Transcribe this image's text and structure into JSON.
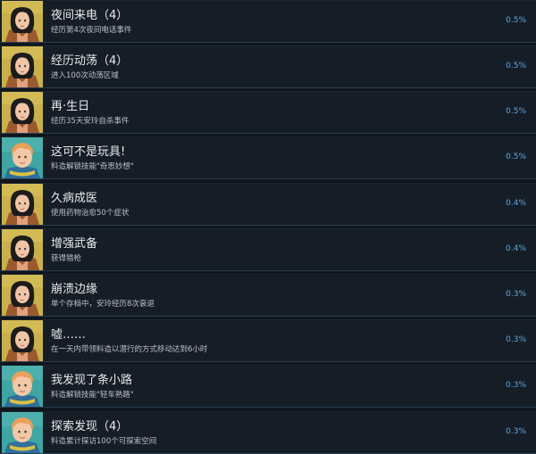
{
  "achievements": [
    {
      "title": "夜间来电（4）",
      "description": "经历第4次夜间电话事件",
      "percent": "0.5%",
      "avatar": "woman-dark-hair"
    },
    {
      "title": "经历动荡（4）",
      "description": "进入100次动荡区域",
      "percent": "0.5%",
      "avatar": "woman-dark-hair"
    },
    {
      "title": "再·生日",
      "description": "经历35天安玲自杀事件",
      "percent": "0.5%",
      "avatar": "woman-dark-hair"
    },
    {
      "title": "这可不是玩具!",
      "description": "料造解锁技能\"奇思妙想\"",
      "percent": "0.5%",
      "avatar": "boy-orange-hair"
    },
    {
      "title": "久病成医",
      "description": "使用药物治愈50个症状",
      "percent": "0.4%",
      "avatar": "woman-dark-hair"
    },
    {
      "title": "增强武备",
      "description": "获得猎枪",
      "percent": "0.4%",
      "avatar": "woman-dark-hair"
    },
    {
      "title": "崩溃边缘",
      "description": "单个存档中，安玲经历8次衰退",
      "percent": "0.3%",
      "avatar": "woman-dark-hair"
    },
    {
      "title": "嘘……",
      "description": "在一天内带领料造以潜行的方式移动达到6小时",
      "percent": "0.3%",
      "avatar": "woman-dark-hair"
    },
    {
      "title": "我发现了条小路",
      "description": "料造解锁技能\"轻车熟路\"",
      "percent": "0.3%",
      "avatar": "boy-orange-hair"
    },
    {
      "title": "探索发现（4）",
      "description": "料造累计探访100个可探索空间",
      "percent": "0.3%",
      "avatar": "boy-orange-hair"
    }
  ]
}
